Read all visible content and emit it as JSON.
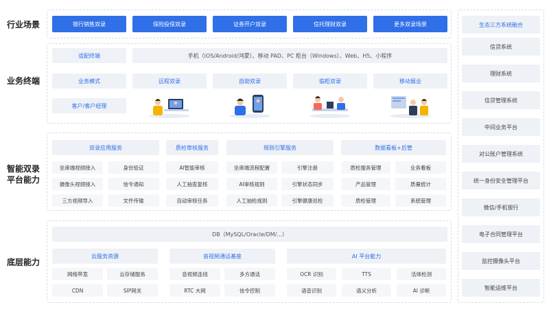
{
  "sections": {
    "industry": "行业场景",
    "terminal": "业务终端",
    "platform_line1": "智能双录",
    "platform_line2": "平台能力",
    "base": "底层能力"
  },
  "industry": {
    "items": [
      "银行销售双录",
      "保险投保双录",
      "证券开户双录",
      "信托理财双录",
      "更多双录场景"
    ]
  },
  "terminal": {
    "adapt_label": "适配终端",
    "devices": "手机（iOS/Android/鸿蒙）、移动 PAD、PC 柜台（Windows）、Web、H5、小程序",
    "mode_label": "业务模式",
    "client_label": "客户/客户经理",
    "modes": [
      "远程双录",
      "自助双录",
      "临柜双录",
      "移动展业"
    ]
  },
  "platform": {
    "headers": [
      "双录应用服务",
      "质检审核服务",
      "规则引擎服务",
      "数据看板+后管"
    ],
    "app_service": [
      [
        "坐席端视频接入",
        "身份验证"
      ],
      [
        "摄像头视频接入",
        "信令通知"
      ],
      [
        "三方视频导入",
        "文件传输"
      ]
    ],
    "qc_service": [
      "AI智能审核",
      "人工抽查复核",
      "自动审核任务"
    ],
    "rule_service": [
      [
        "坐席端流程配置",
        "引擎注册"
      ],
      [
        "AI审核规则",
        "引擎状态同步"
      ],
      [
        "人工抽检规则",
        "引擎健康巡检"
      ]
    ],
    "dashboard": [
      [
        "质检服务管理",
        "业务看板"
      ],
      [
        "产品管理",
        "质量统计"
      ],
      [
        "质检管理",
        "系统管理"
      ]
    ]
  },
  "base": {
    "db": "DB（MySQL/Oracle/DM/...）",
    "cloud_header": "云服务资源",
    "cloud": [
      [
        "网络带宽",
        "云存储服务"
      ],
      [
        "CDN",
        "SIP网关"
      ]
    ],
    "av_header": "音视频通话基座",
    "av": [
      [
        "音视频连线",
        "多方通话"
      ],
      [
        "RTC 大网",
        "信令控制"
      ]
    ],
    "ai_header": "AI 平台能力",
    "ai": [
      [
        "OCR 识别",
        "TTS",
        "活体检测"
      ],
      [
        "语音识别",
        "语义分析",
        "AI 诊断"
      ]
    ]
  },
  "right": {
    "header": "生态三方系统融合",
    "items": [
      "信贷系统",
      "理财系统",
      "信贷管理系统",
      "中间业务平台",
      "对公账户管理系统",
      "统一身份安全管理平台",
      "微信/手机银行",
      "电子合同管理平台",
      "监控摄像头平台",
      "智能运维平台"
    ]
  },
  "colors": {
    "accent": "#2f6fe8",
    "tile": "#eef1f6",
    "border": "#d6dbe4"
  }
}
